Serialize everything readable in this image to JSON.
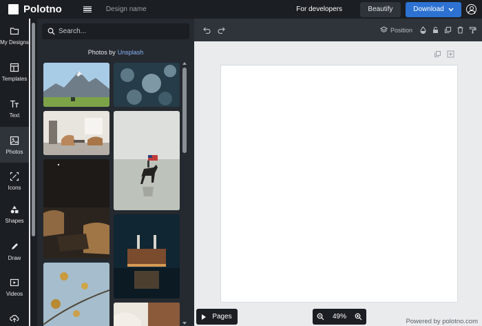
{
  "app": {
    "title": "Polotno",
    "design_name": "Design name"
  },
  "header": {
    "for_developers": "For developers",
    "beautify": "Beautify",
    "download": "Download"
  },
  "sidebar": {
    "items": [
      {
        "label": "My Designs",
        "icon": "folder-icon"
      },
      {
        "label": "Templates",
        "icon": "layout-icon"
      },
      {
        "label": "Text",
        "icon": "text-icon"
      },
      {
        "label": "Photos",
        "icon": "image-icon",
        "active": true
      },
      {
        "label": "Icons",
        "icon": "icons-icon"
      },
      {
        "label": "Shapes",
        "icon": "shapes-icon"
      },
      {
        "label": "Draw",
        "icon": "pencil-icon"
      },
      {
        "label": "Videos",
        "icon": "video-icon"
      },
      {
        "label": "",
        "icon": "upload-icon"
      }
    ]
  },
  "photos_panel": {
    "search_placeholder": "Search...",
    "credit_prefix": "Photos by",
    "credit_link": "Unsplash",
    "photos": [
      {
        "desc": "mountain-landscape",
        "colors": [
          "#9cc3e3",
          "#6e7f8d",
          "#7fa34b"
        ]
      },
      {
        "desc": "frosted-leaves",
        "colors": [
          "#2e4552",
          "#6d8795",
          "#1a2a33"
        ]
      },
      {
        "desc": "living-room",
        "colors": [
          "#e7e3dc",
          "#b7865c",
          "#8f8a83"
        ]
      },
      {
        "desc": "horse-rider-beach",
        "colors": [
          "#d9dcd8",
          "#b6bcb5",
          "#2b2a28"
        ]
      },
      {
        "desc": "dark-interior",
        "colors": [
          "#1d1a17",
          "#3a2e23",
          "#a07646"
        ]
      },
      {
        "desc": "power-station-night",
        "colors": [
          "#0f2532",
          "#3f6d85",
          "#c9874a"
        ]
      },
      {
        "desc": "autumn-branch",
        "colors": [
          "#9fb9c9",
          "#c69a3f",
          "#6b8697"
        ]
      },
      {
        "desc": "pottery-studio",
        "colors": [
          "#e4ded5",
          "#8a5a3b",
          "#efe9e1"
        ]
      }
    ]
  },
  "toolbar": {
    "position": "Position"
  },
  "footer": {
    "pages": "Pages",
    "zoom": "49%",
    "powered_by": "Powered by polotno.com"
  },
  "colors": {
    "accent": "#2d72d2",
    "dark": "#1b1e22",
    "panel": "#252a30",
    "workspace": "#e9ebed"
  }
}
